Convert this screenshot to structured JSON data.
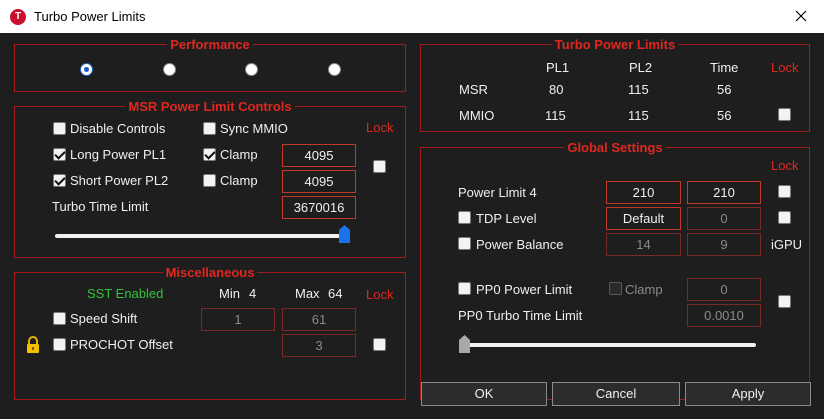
{
  "window": {
    "title": "Turbo Power Limits",
    "icon": "app-icon-t",
    "icon_letter": "T"
  },
  "performance": {
    "legend": "Performance",
    "selected_index": 0,
    "options": 4
  },
  "msr": {
    "legend": "MSR Power Limit Controls",
    "lock_label": "Lock",
    "disable_controls": "Disable Controls",
    "sync_mmio": "Sync MMIO",
    "long_pl1": "Long Power PL1",
    "short_pl2": "Short Power PL2",
    "clamp": "Clamp",
    "pl1_value": "4095",
    "pl2_value": "4095",
    "turbo_time_label": "Turbo Time Limit",
    "turbo_time_value": "3670016",
    "slider_level": 1.0
  },
  "misc": {
    "legend": "Miscellaneous",
    "sst_status": "SST Enabled",
    "min_label": "Min",
    "min_value": "4",
    "max_label": "Max",
    "max_value": "64",
    "lock_label": "Lock",
    "speed_shift": "Speed Shift",
    "speed_shift_min": "1",
    "speed_shift_max": "61",
    "prochot_offset": "PROCHOT Offset",
    "prochot_value": "3"
  },
  "turbo": {
    "legend": "Turbo Power Limits",
    "col_pl1": "PL1",
    "col_pl2": "PL2",
    "col_time": "Time",
    "lock_label": "Lock",
    "rows": [
      {
        "name": "MSR",
        "pl1": "80",
        "pl2": "115",
        "time": "56"
      },
      {
        "name": "MMIO",
        "pl1": "115",
        "pl2": "115",
        "time": "56"
      }
    ]
  },
  "global": {
    "legend": "Global Settings",
    "lock_label": "Lock",
    "power_limit4_label": "Power Limit 4",
    "power_limit4_a": "210",
    "power_limit4_b": "210",
    "tdp_level_label": "TDP Level",
    "tdp_level_value": "Default",
    "tdp_level_b": "0",
    "power_balance_label": "Power Balance",
    "power_balance_a": "14",
    "power_balance_b": "9",
    "igpu_label": "iGPU",
    "pp0_power_limit_label": "PP0 Power Limit",
    "pp0_clamp_label": "Clamp",
    "pp0_value": "0",
    "pp0_turbo_label": "PP0 Turbo Time Limit",
    "pp0_turbo_value": "0.0010",
    "slider_level": 0.0
  },
  "buttons": {
    "ok": "OK",
    "cancel": "Cancel",
    "apply": "Apply"
  },
  "colors": {
    "accent_red": "#e0271f",
    "border_red": "#a01b1b",
    "status_green": "#33c23d",
    "radio_blue": "#1756c4"
  }
}
